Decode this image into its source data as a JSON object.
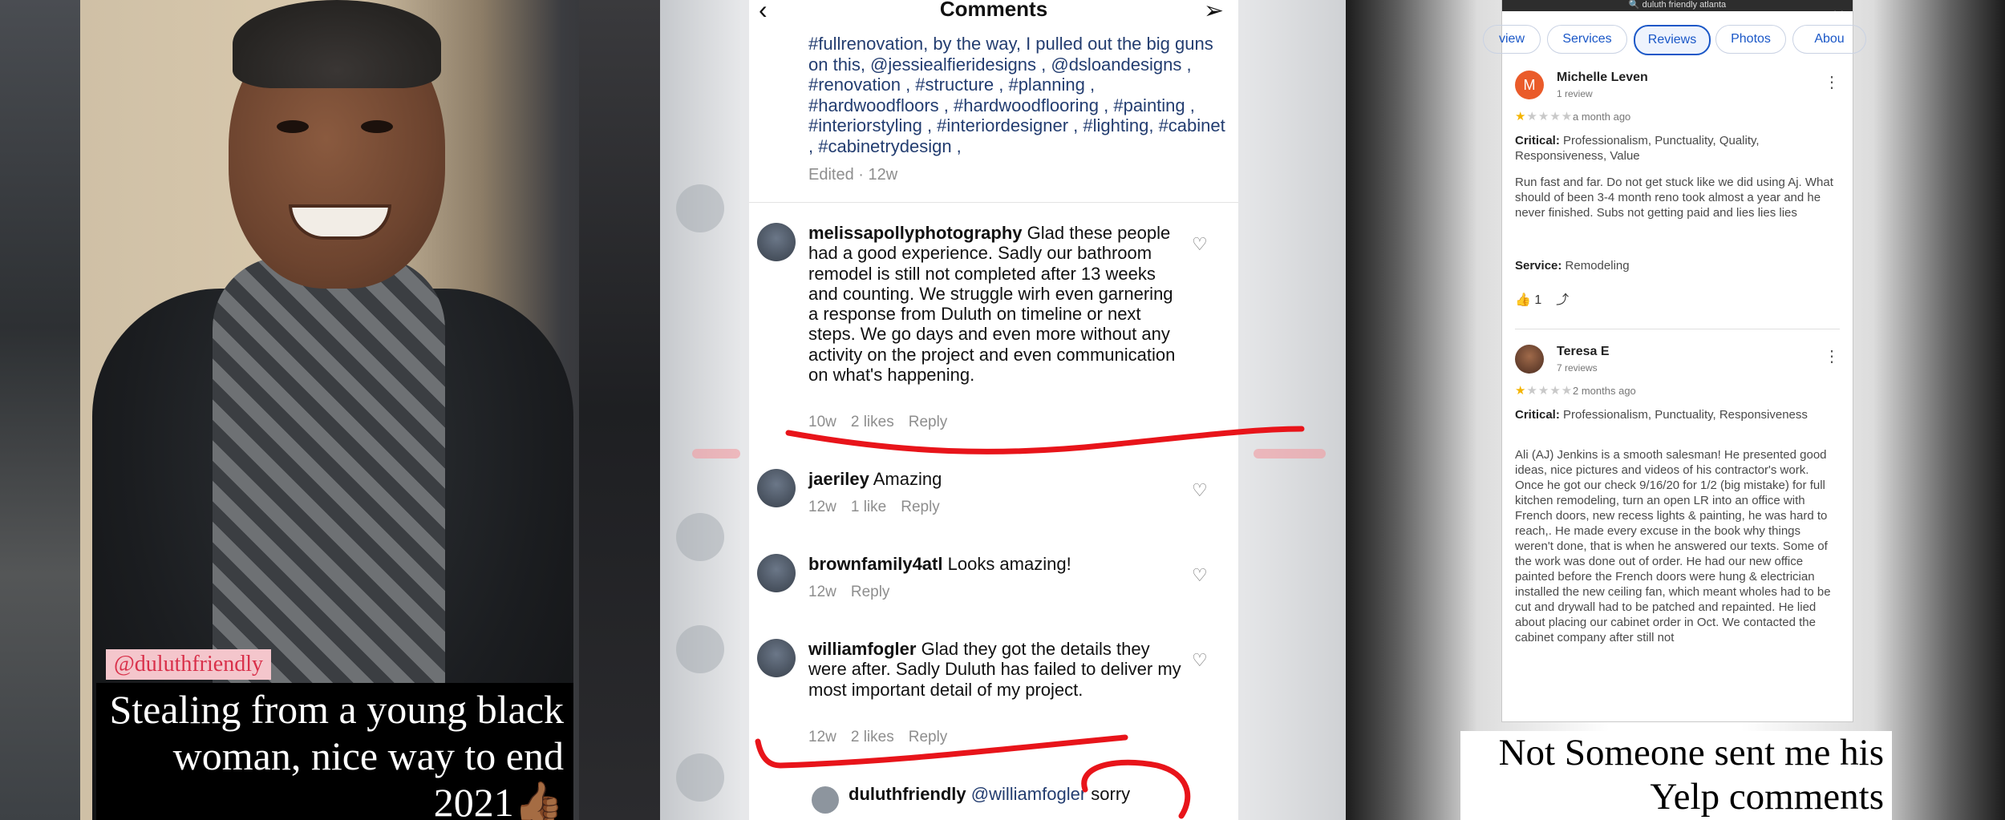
{
  "panel1": {
    "tag": "@duluthfriendly",
    "caption": "Stealing from a young black woman, nice way to end 2021👍🏾"
  },
  "panel2": {
    "header_title": "Comments",
    "post_caption": "#fullrenovation, by the way, I pulled out the big guns on this, @jessiealfieridesigns , @dsloandesigns , #renovation , #structure , #planning , #hardwoodfloors , #hardwoodflooring , #painting , #interiorstyling , #interiordesigner , #lighting, #cabinet , #cabinetrydesign ,",
    "edited_label": "Edited · 12w",
    "comments": [
      {
        "user": "melissapollyphotography",
        "text": "Glad these people had a good experience. Sadly our bathroom remodel is still not completed after 13 weeks and counting. We struggle wirh even garnering a response from Duluth on timeline or next steps. We go days and even more without any activity on the project and even communication on what's happening.",
        "time": "10w",
        "likes": "2 likes",
        "reply": "Reply"
      },
      {
        "user": "jaeriley",
        "text": "Amazing",
        "time": "12w",
        "likes": "1 like",
        "reply": "Reply"
      },
      {
        "user": "brownfamily4atl",
        "text": "Looks amazing!",
        "time": "12w",
        "likes": "",
        "reply": "Reply"
      },
      {
        "user": "williamfogler",
        "text": "Glad they got the details they were after. Sadly Duluth has failed to deliver my most important detail of my project.",
        "time": "12w",
        "likes": "2 likes",
        "reply": "Reply"
      }
    ],
    "reply": {
      "user": "duluthfriendly",
      "mention": "@williamfogler",
      "text": "sorry"
    }
  },
  "panel3": {
    "search_text": "duluth friendly atlanta",
    "tabs": [
      "view",
      "Services",
      "Reviews",
      "Photos",
      "Abou"
    ],
    "active_tab": "Reviews",
    "reviews": [
      {
        "name": "Michelle Leven",
        "count": "1 review",
        "initial": "M",
        "ago": "a month ago",
        "critical_label": "Critical:",
        "critical": "Professionalism, Punctuality, Quality, Responsiveness, Value",
        "body": "Run fast and far.  Do not get stuck like we did using Aj.   What should of been 3-4 month reno took almost a year and he never finished.  Subs not getting paid and lies lies lies",
        "service_label": "Service:",
        "service": "Remodeling",
        "helpful": "1"
      },
      {
        "name": "Teresa E",
        "count": "7 reviews",
        "ago": "2 months ago",
        "critical_label": "Critical:",
        "critical": "Professionalism, Punctuality, Responsiveness",
        "body": "Ali (AJ) Jenkins is a smooth salesman! He presented good ideas, nice pictures and videos of his contractor's work. Once he got our check 9/16/20 for 1/2 (big mistake) for full kitchen remodeling, turn an open LR into an office with French doors, new recess lights & painting, he was hard to reach,. He made every excuse in the book why things weren't done, that is when he answered our texts. Some of the work was done out of order. He had our new office painted before the French doors were hung & electrician installed the new ceiling fan, which meant wholes had to be cut and drywall had to be patched and repainted. He lied about placing our cabinet order in Oct. We contacted the cabinet company after still not"
      }
    ],
    "caption": "Not Someone sent me his Yelp comments"
  },
  "colors": {
    "red_annotation": "#e8141a",
    "link_blue": "#233d70",
    "tab_blue": "#1a57c7",
    "star_yellow": "#f4b400"
  }
}
